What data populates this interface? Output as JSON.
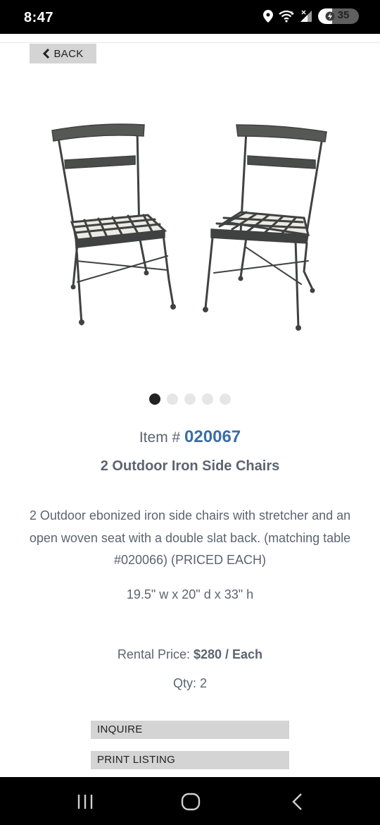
{
  "status_bar": {
    "time": "8:47",
    "battery_percent": "35",
    "battery_level": 0.35,
    "icons": [
      "location-icon",
      "wifi-icon",
      "signal-icon",
      "battery-icon"
    ]
  },
  "header": {
    "back_label": "BACK"
  },
  "gallery": {
    "image_description_icon": "chairs-photo",
    "slide_count": 5,
    "active_slide": 1
  },
  "product": {
    "item_prefix": "Item #",
    "item_number": "020067",
    "title": "2 Outdoor Iron Side Chairs",
    "description": "2 Outdoor ebonized iron side chairs with stretcher and an open woven seat with a double slat back. (matching table #020066) (PRICED EACH)",
    "dimensions": "19.5\" w x 20\" d x 33\" h",
    "price_label": "Rental Price:",
    "price_value": "$280 / Each",
    "qty_text": "Qty: 2"
  },
  "actions": {
    "inquire_label": "INQUIRE",
    "print_label": "PRINT LISTING"
  },
  "colors": {
    "accent": "#3a6ea8",
    "text": "#5b6470",
    "button_bg": "#d4d4d4"
  },
  "nav_bar": {
    "buttons": [
      "recent-apps-icon",
      "home-icon",
      "back-nav-icon"
    ]
  }
}
